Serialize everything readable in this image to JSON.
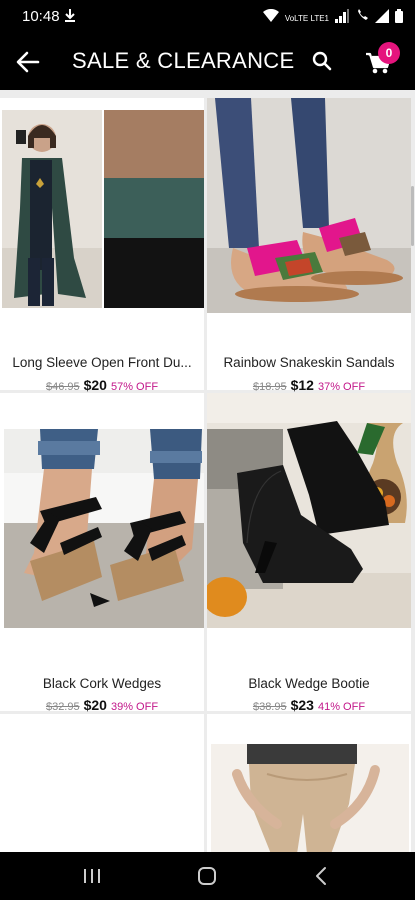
{
  "status": {
    "time": "10:48",
    "network_label": "VoLTE LTE1"
  },
  "header": {
    "title": "SALE & CLEARANCE",
    "cart_count": "0"
  },
  "products": [
    {
      "name": "Long Sleeve Open Front Du...",
      "old_price": "$46.95",
      "price": "$20",
      "discount": "57% OFF"
    },
    {
      "name": "Rainbow Snakeskin Sandals",
      "old_price": "$18.95",
      "price": "$12",
      "discount": "37% OFF"
    },
    {
      "name": "Black Cork Wedges",
      "old_price": "$32.95",
      "price": "$20",
      "discount": "39% OFF"
    },
    {
      "name": "Black Wedge Bootie",
      "old_price": "$38.95",
      "price": "$23",
      "discount": "41% OFF"
    }
  ],
  "colors": {
    "accent": "#e5147d",
    "discount": "#c2178a",
    "header_bg": "#000000"
  },
  "icons": {
    "back": "arrow-left-icon",
    "search": "search-icon",
    "cart": "cart-icon",
    "download": "download-icon",
    "nav_recent": "recent-apps-icon",
    "nav_home": "home-icon",
    "nav_back": "back-icon"
  }
}
